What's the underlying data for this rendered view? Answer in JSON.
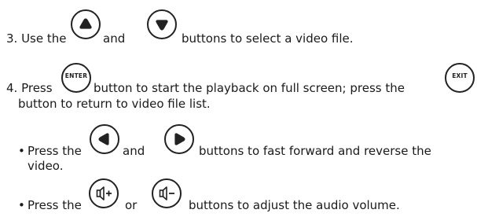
{
  "step3": {
    "prefix": "3. Use the",
    "and": "and",
    "suffix": "buttons to select a video file.",
    "button_up_icon": "up-arrow-button-icon",
    "button_down_icon": "down-arrow-button-icon"
  },
  "step4": {
    "prefix": "4. Press",
    "enter_label": "ENTER",
    "middle": "button to start the playback on full screen; press the",
    "exit_label": "EXIT",
    "line2": "button to return to video file list."
  },
  "bullet1": {
    "bullet": "•",
    "prefix": "Press the",
    "and": "and",
    "suffix": "buttons to fast forward and reverse the",
    "line2": "video.",
    "button_left_icon": "left-arrow-button-icon",
    "button_right_icon": "right-arrow-button-icon"
  },
  "bullet2": {
    "bullet": "•",
    "prefix": "Press the",
    "or": "or",
    "suffix": "buttons to adjust the audio volume.",
    "button_volup_icon": "volume-up-button-icon",
    "button_voldown_icon": "volume-down-button-icon"
  },
  "colors": {
    "text": "#1a1a1a",
    "button_outline": "#222222",
    "button_fill": "#222222"
  }
}
